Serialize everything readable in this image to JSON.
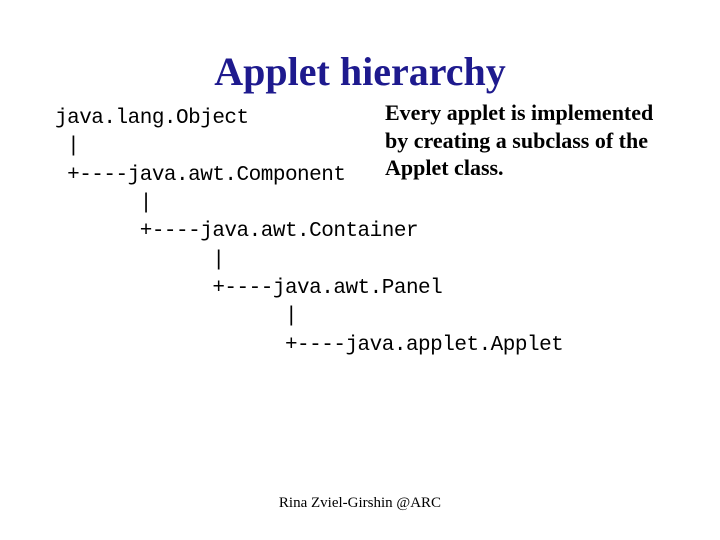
{
  "title": "Applet hierarchy",
  "tree": {
    "l1": "java.lang.Object",
    "l2": " |",
    "l3": " +----java.awt.Component",
    "l4": "       |",
    "l5": "       +----java.awt.Container",
    "l6": "             |",
    "l7": "             +----java.awt.Panel",
    "l8": "                   |",
    "l9": "                   +----java.applet.Applet"
  },
  "description": "Every applet is implemented by creating a subclass of the Applet class.",
  "footer": "Rina Zviel-Girshin   @ARC"
}
